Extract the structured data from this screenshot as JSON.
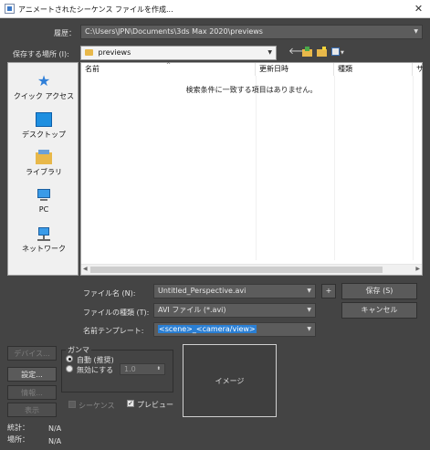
{
  "window": {
    "title": "アニメートされたシーケンス ファイルを作成...",
    "close_glyph": "✕"
  },
  "history": {
    "label": "履歴：",
    "value": "C:\\Users\\JPN\\Documents\\3ds Max 2020\\previews"
  },
  "save_in": {
    "label": "保存する場所 (I):",
    "value": "previews"
  },
  "places": [
    {
      "label": "クイック アクセス",
      "icon": "star-icon"
    },
    {
      "label": "デスクトップ",
      "icon": "desktop-icon"
    },
    {
      "label": "ライブラリ",
      "icon": "library-icon"
    },
    {
      "label": "PC",
      "icon": "pc-icon"
    },
    {
      "label": "ネットワーク",
      "icon": "network-icon"
    }
  ],
  "file_list": {
    "columns": [
      "名前",
      "更新日時",
      "種類",
      "サ"
    ],
    "empty_message": "検索条件に一致する項目はありません。"
  },
  "file_name": {
    "label": "ファイル名 (N):",
    "value": "Untitled_Perspective.avi"
  },
  "file_type": {
    "label": "ファイルの種類 (T):",
    "value": "AVI ファイル (*.avi)"
  },
  "name_template": {
    "label": "名前テンプレート:",
    "value": "<scene>_<camera/view>"
  },
  "buttons": {
    "save": "保存 (S)",
    "cancel": "キャンセル",
    "plus": "+",
    "devices": "デバイス...",
    "setup": "設定...",
    "info": "情報...",
    "view": "表示"
  },
  "gamma": {
    "title": "ガンマ",
    "auto": "自動 (推奨)",
    "override": "無効にする",
    "override_value": "1.0"
  },
  "sequence_label": "シーケンス",
  "preview_label": "プレビュー",
  "image_label": "イメージ",
  "stats": {
    "label": "統計：",
    "value": "N/A"
  },
  "location": {
    "label": "場所：",
    "value": "N/A"
  }
}
